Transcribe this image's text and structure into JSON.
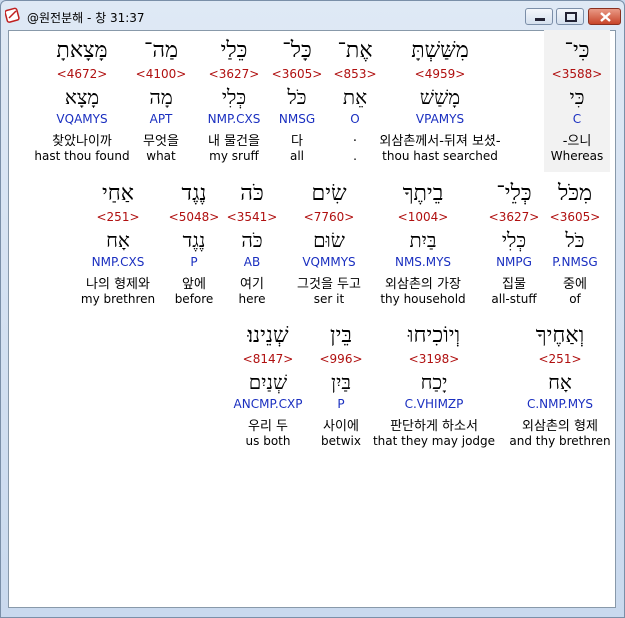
{
  "window": {
    "title": "@원전분해 - 창 31:37",
    "icon": "bible-app-icon",
    "buttons": {
      "minimize": "minimize-icon",
      "maximize": "maximize-icon",
      "close": "close-icon"
    }
  },
  "rows": [
    [
      {
        "heb": "כִּי־",
        "num": "<3588>",
        "lemma": "כִּי",
        "parse": "C",
        "kor": "-으니",
        "eng": "Whereas"
      },
      {
        "heb": "מִשַּׁשְׁתָּ",
        "num": "<4959>",
        "lemma": "מָשַׁשׁ",
        "parse": "VPAMYS",
        "kor": "외삼촌께서-뒤져 보셨-",
        "eng": "thou hast searched"
      },
      {
        "heb": "אֶת־",
        "num": "<853>",
        "lemma": "אֵת",
        "parse": "O",
        "kor": ".",
        "eng": "."
      },
      {
        "heb": "כָּל־",
        "num": "<3605>",
        "lemma": "כֹּל",
        "parse": "NMSG",
        "kor": "다",
        "eng": "all"
      },
      {
        "heb": "כֵּלַי",
        "num": "<3627>",
        "lemma": "כְּלִי",
        "parse": "NMP.CXS",
        "kor": "내 물건을",
        "eng": "my sruff"
      },
      {
        "heb": "מַה־",
        "num": "<4100>",
        "lemma": "מָה",
        "parse": "APT",
        "kor": "무엇을",
        "eng": "what"
      },
      {
        "heb": "מָּצָאתָ",
        "num": "<4672>",
        "lemma": "מָצָא",
        "parse": "VQAMYS",
        "kor": "찾았나이까",
        "eng": "hast thou found"
      }
    ],
    [
      {
        "heb": "מִכֹּל",
        "num": "<3605>",
        "lemma": "כֹּל",
        "parse": "P.NMSG",
        "kor": "중에",
        "eng": "of"
      },
      {
        "heb": "כְּלֵי־",
        "num": "<3627>",
        "lemma": "כְּלִי",
        "parse": "NMPG",
        "kor": "집물",
        "eng": "all-stuff"
      },
      {
        "heb": "בֵיתֶךָ",
        "num": "<1004>",
        "lemma": "בַּיִת",
        "parse": "NMS.MYS",
        "kor": "외삼촌의 가장",
        "eng": "thy household"
      },
      {
        "heb": "שִׂים",
        "num": "<7760>",
        "lemma": "שׂוּם",
        "parse": "VQMMYS",
        "kor": "그것을 두고",
        "eng": "ser it"
      },
      {
        "heb": "כֹּה",
        "num": "<3541>",
        "lemma": "כֹּה",
        "parse": "AB",
        "kor": "여기",
        "eng": "here"
      },
      {
        "heb": "נֶגֶד",
        "num": "<5048>",
        "lemma": "נֶגֶד",
        "parse": "P",
        "kor": "앞에",
        "eng": "before"
      },
      {
        "heb": "אַחַי",
        "num": "<251>",
        "lemma": "אָח",
        "parse": "NMP.CXS",
        "kor": "나의 형제와",
        "eng": "my brethren"
      }
    ],
    [
      {
        "heb": "וְאַחֶיךָ",
        "num": "<251>",
        "lemma": "אָח",
        "parse": "C.NMP.MYS",
        "kor": "외삼촌의 형제",
        "eng": "and thy brethren"
      },
      {
        "heb": "וְיוֹכִיחוּ",
        "num": "<3198>",
        "lemma": "יָכַח",
        "parse": "C.VHIMZP",
        "kor": "판단하게 하소서",
        "eng": "that they may jodge"
      },
      {
        "heb": "בֵּין",
        "num": "<996>",
        "lemma": "בַּיִן",
        "parse": "P",
        "kor": "사이에",
        "eng": "betwix"
      },
      {
        "heb": "שְׁנֵינוּ׃",
        "num": "<8147>",
        "lemma": "שְׁנַיִם",
        "parse": "ANCMP.CXP",
        "kor": "우리 두",
        "eng": "us both"
      }
    ]
  ]
}
